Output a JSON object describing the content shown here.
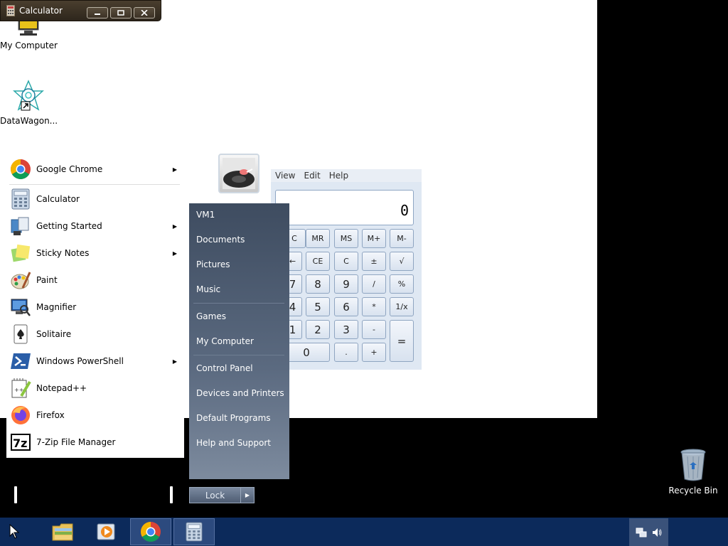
{
  "desktop": {
    "icons": [
      {
        "label": "My Computer"
      },
      {
        "label": "DataWagon..."
      },
      {
        "label": "Recycle Bin"
      }
    ]
  },
  "calculator": {
    "title": "Calculator",
    "menu": [
      "View",
      "Edit",
      "Help"
    ],
    "display": "0",
    "buttons": {
      "mc": "C",
      "mr": "MR",
      "ms": "MS",
      "mplus": "M+",
      "mminus": "M-",
      "back": "←",
      "ce": "CE",
      "c": "C",
      "plusminus": "±",
      "sqrt": "√",
      "seven": "7",
      "eight": "8",
      "nine": "9",
      "div": "/",
      "pct": "%",
      "four": "4",
      "five": "5",
      "six": "6",
      "mul": "*",
      "recip": "1/x",
      "one": "1",
      "two": "2",
      "three": "3",
      "sub": "-",
      "equals": "=",
      "zero": "0",
      "dot": ".",
      "add": "+"
    }
  },
  "start_menu": {
    "pinned": [
      {
        "label": "Google Chrome",
        "submenu": true
      },
      {
        "label": "Calculator",
        "submenu": false
      },
      {
        "label": "Getting Started",
        "submenu": true
      },
      {
        "label": "Sticky Notes",
        "submenu": true
      },
      {
        "label": "Paint",
        "submenu": false
      },
      {
        "label": "Magnifier",
        "submenu": false
      },
      {
        "label": "Solitaire",
        "submenu": false
      },
      {
        "label": "Windows PowerShell",
        "submenu": true
      },
      {
        "label": "Notepad++",
        "submenu": false
      },
      {
        "label": "Firefox",
        "submenu": false
      },
      {
        "label": "7-Zip File Manager",
        "submenu": false
      }
    ],
    "right": [
      {
        "label": "VM1"
      },
      {
        "label": "Documents"
      },
      {
        "label": "Pictures"
      },
      {
        "label": "Music"
      },
      {
        "label": "Games"
      },
      {
        "label": "My Computer"
      },
      {
        "label": "Control Panel"
      },
      {
        "label": "Devices and Printers"
      },
      {
        "label": "Default Programs"
      },
      {
        "label": "Help and Support"
      }
    ],
    "lock_label": "Lock"
  },
  "colors": {
    "taskbar": "#0c2a5b",
    "start_right_top": "#3e4c60",
    "calc_body": "#dfe8f3"
  }
}
